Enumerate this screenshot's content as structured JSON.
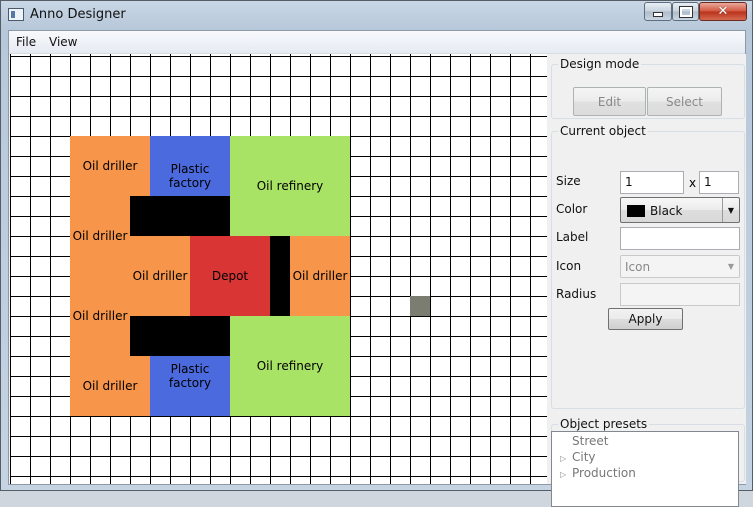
{
  "window": {
    "title": "Anno Designer",
    "controls": {
      "minimize": "minimize-icon",
      "maximize": "maximize-icon",
      "close": "close-icon"
    }
  },
  "menu": {
    "items": [
      "File",
      "View"
    ]
  },
  "canvas": {
    "objects": [
      {
        "type": "oil-driller",
        "label": "Oil driller",
        "color": "#f7954a"
      },
      {
        "type": "oil-driller",
        "label": "Oil driller",
        "color": "#f7954a"
      },
      {
        "type": "oil-driller",
        "label": "Oil driller",
        "color": "#f7954a"
      },
      {
        "type": "oil-driller",
        "label": "Oil driller",
        "color": "#f7954a"
      },
      {
        "type": "oil-driller",
        "label": "Oil driller",
        "color": "#f7954a"
      },
      {
        "type": "oil-driller",
        "label": "Oil driller",
        "color": "#f7954a"
      },
      {
        "type": "plastic-factory",
        "label": "Plastic factory",
        "color": "#4b6ade"
      },
      {
        "type": "plastic-factory",
        "label": "Plastic factory",
        "color": "#4b6ade"
      },
      {
        "type": "oil-refinery",
        "label": "Oil refinery",
        "color": "#a9e366"
      },
      {
        "type": "oil-refinery",
        "label": "Oil refinery",
        "color": "#a9e366"
      },
      {
        "type": "depot",
        "label": "Depot",
        "color": "#d93535"
      }
    ]
  },
  "design_mode": {
    "title": "Design mode",
    "edit_label": "Edit",
    "select_label": "Select"
  },
  "current_object": {
    "title": "Current object",
    "size_label": "Size",
    "size_width": "1",
    "size_separator": "x",
    "size_height": "1",
    "color_label": "Color",
    "color_value": "Black",
    "color_swatch": "#000000",
    "label_label": "Label",
    "label_value": "",
    "icon_label": "Icon",
    "icon_value": "Icon",
    "radius_label": "Radius",
    "radius_value": "",
    "apply_label": "Apply"
  },
  "object_presets": {
    "title": "Object presets",
    "items": [
      "Street",
      "City",
      "Production"
    ]
  }
}
